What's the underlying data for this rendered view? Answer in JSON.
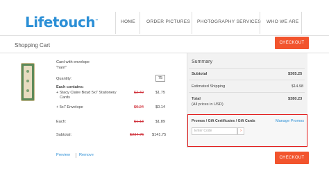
{
  "brand": {
    "name": "Lifetouch",
    "color": "#2b8fd6"
  },
  "nav": {
    "items": [
      {
        "label": "HOME"
      },
      {
        "label": "ORDER PICTURES"
      },
      {
        "label": "PHOTOGRAPHY SERVICES"
      },
      {
        "label": "WHO WE ARE"
      }
    ]
  },
  "cart": {
    "title": "Shopping Cart",
    "checkout_label": "CHECKOUT",
    "accent": "#f2542d"
  },
  "item": {
    "name": "Card with envelope",
    "name_sub": "\"harri\"",
    "quantity_label": "Quantity:",
    "quantity_value": "75",
    "contains_label": "Each contains:",
    "components": [
      {
        "name": "+ Stacy Claire Boyd 5x7 Stationery",
        "name2": "Cards",
        "original": "$2.49",
        "price": "$1.75"
      },
      {
        "name": "+ 5x7 Envelope",
        "original": "$0.24",
        "price": "$0.14"
      }
    ],
    "each_label": "Each:",
    "each_original": "$1.13",
    "each_price": "$1.89",
    "subtotal_label": "Subtotal:",
    "subtotal_original": "$234.75",
    "subtotal_price": "$141.75",
    "preview_label": "Preview",
    "remove_label": "Remove"
  },
  "summary": {
    "title": "Summary",
    "subtotal_label": "Subtotal",
    "subtotal_value": "$365.25",
    "shipping_label": "Estimated Shipping",
    "shipping_value": "$14.98",
    "total_label": "Total",
    "total_value": "$380.23",
    "currency_note": "(All prices in USD)",
    "promo_title": "Promos / Gift Certificates / Gift Cards",
    "manage_promos": "Manage Promos",
    "promo_placeholder": "Enter Code",
    "go_icon": "›",
    "highlight": "#e21b1b"
  }
}
